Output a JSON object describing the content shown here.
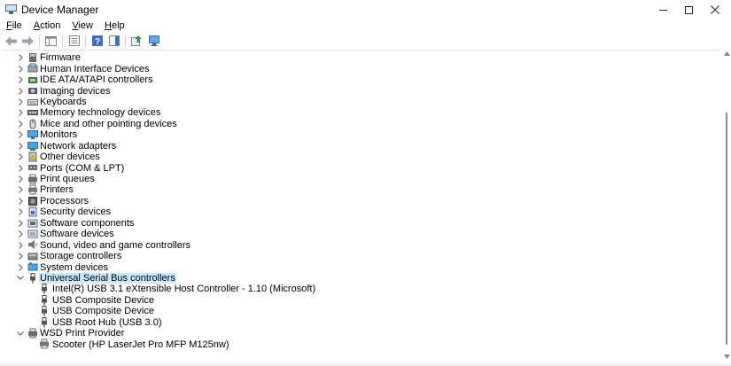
{
  "window": {
    "title": "Device Manager",
    "min_glyph": "—",
    "max_glyph": "☐",
    "close_glyph": "✕"
  },
  "menu": [
    {
      "label": "File",
      "accel": "F",
      "rest": "ile"
    },
    {
      "label": "Action",
      "accel": "A",
      "rest": "ction"
    },
    {
      "label": "View",
      "accel": "V",
      "rest": "iew"
    },
    {
      "label": "Help",
      "accel": "H",
      "rest": "elp"
    }
  ],
  "tree": {
    "categories": [
      {
        "label": "Firmware",
        "icon": "firmware-icon",
        "expanded": false
      },
      {
        "label": "Human Interface Devices",
        "icon": "hid-icon",
        "expanded": false
      },
      {
        "label": "IDE ATA/ATAPI controllers",
        "icon": "ide-controller-icon",
        "expanded": false
      },
      {
        "label": "Imaging devices",
        "icon": "camera-icon",
        "expanded": false
      },
      {
        "label": "Keyboards",
        "icon": "keyboard-icon",
        "expanded": false
      },
      {
        "label": "Memory technology devices",
        "icon": "memory-icon",
        "expanded": false
      },
      {
        "label": "Mice and other pointing devices",
        "icon": "mouse-icon",
        "expanded": false
      },
      {
        "label": "Monitors",
        "icon": "monitor-icon",
        "expanded": false
      },
      {
        "label": "Network adapters",
        "icon": "network-icon",
        "expanded": false
      },
      {
        "label": "Other devices",
        "icon": "unknown-device-icon",
        "expanded": false
      },
      {
        "label": "Ports (COM & LPT)",
        "icon": "port-icon",
        "expanded": false
      },
      {
        "label": "Print queues",
        "icon": "print-queue-icon",
        "expanded": false
      },
      {
        "label": "Printers",
        "icon": "printer-icon",
        "expanded": false
      },
      {
        "label": "Processors",
        "icon": "processor-icon",
        "expanded": false
      },
      {
        "label": "Security devices",
        "icon": "security-icon",
        "expanded": false
      },
      {
        "label": "Software components",
        "icon": "software-component-icon",
        "expanded": false
      },
      {
        "label": "Software devices",
        "icon": "software-device-icon",
        "expanded": false
      },
      {
        "label": "Sound, video and game controllers",
        "icon": "speaker-icon",
        "expanded": false
      },
      {
        "label": "Storage controllers",
        "icon": "storage-icon",
        "expanded": false
      },
      {
        "label": "System devices",
        "icon": "system-icon",
        "expanded": false
      },
      {
        "label": "Universal Serial Bus controllers",
        "icon": "usb-icon",
        "expanded": true,
        "selected": true,
        "children": [
          {
            "label": "Intel(R) USB 3.1 eXtensible Host Controller - 1.10 (Microsoft)",
            "icon": "usb-icon"
          },
          {
            "label": "USB Composite Device",
            "icon": "usb-icon"
          },
          {
            "label": "USB Composite Device",
            "icon": "usb-icon"
          },
          {
            "label": "USB Root Hub (USB 3.0)",
            "icon": "usb-icon"
          }
        ]
      },
      {
        "label": "WSD Print Provider",
        "icon": "print-provider-icon",
        "expanded": true,
        "children": [
          {
            "label": "Scooter (HP LaserJet Pro MFP M125nw)",
            "icon": "printer-icon"
          }
        ]
      }
    ]
  },
  "colors": {
    "selection": "#cce8ff",
    "accent_blue": "#1a73c9"
  }
}
